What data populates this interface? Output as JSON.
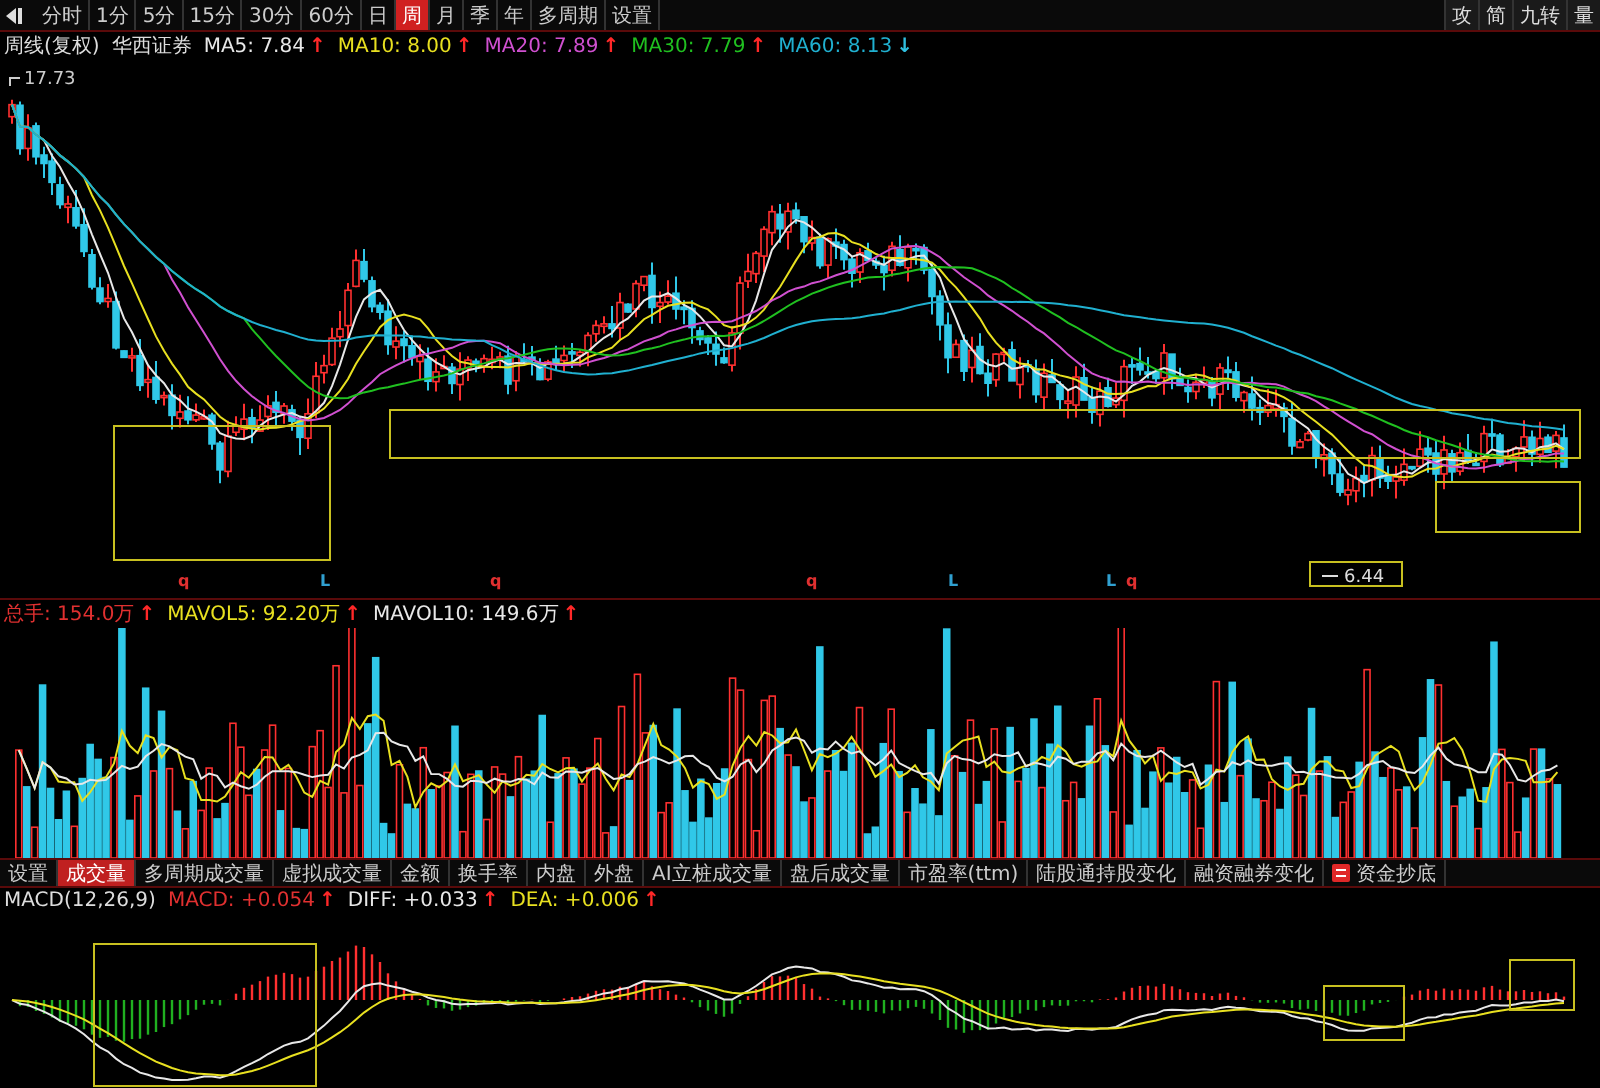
{
  "toolbar": {
    "periods": [
      {
        "label": "分时",
        "selected": false
      },
      {
        "label": "1分",
        "selected": false
      },
      {
        "label": "5分",
        "selected": false
      },
      {
        "label": "15分",
        "selected": false
      },
      {
        "label": "30分",
        "selected": false
      },
      {
        "label": "60分",
        "selected": false
      },
      {
        "label": "日",
        "selected": false
      },
      {
        "label": "周",
        "selected": true
      },
      {
        "label": "月",
        "selected": false
      },
      {
        "label": "季",
        "selected": false
      },
      {
        "label": "年",
        "selected": false
      },
      {
        "label": "多周期",
        "selected": false
      },
      {
        "label": "设置",
        "selected": false
      }
    ],
    "right_buttons": [
      "攻",
      "简",
      "九转",
      "量"
    ]
  },
  "price_legend": {
    "title": "周线(复权)",
    "name": "华西证券",
    "items": [
      {
        "label": "MA5: 7.84",
        "color": "#e8e8e8",
        "arrow": {
          "text": "↑",
          "color": "#ff2828"
        }
      },
      {
        "label": "MA10: 8.00",
        "color": "#e8e020",
        "arrow": {
          "text": "↑",
          "color": "#ff2828"
        }
      },
      {
        "label": "MA20: 7.89",
        "color": "#d050d0",
        "arrow": {
          "text": "↑",
          "color": "#ff2828"
        }
      },
      {
        "label": "MA30: 7.79",
        "color": "#20c020",
        "arrow": {
          "text": "↑",
          "color": "#ff2828"
        }
      },
      {
        "label": "MA60: 8.13",
        "color": "#20b0d0",
        "arrow": {
          "text": "↓",
          "color": "#30c0e0"
        }
      }
    ]
  },
  "price_chart": {
    "high_label": "17.73",
    "low_label": "6.44",
    "markers": [
      {
        "text": "q",
        "color": "#e03030"
      },
      {
        "text": "L",
        "color": "#30a0d0"
      },
      {
        "text": "q",
        "color": "#e03030"
      },
      {
        "text": "q",
        "color": "#e03030"
      },
      {
        "text": "L",
        "color": "#30a0d0"
      },
      {
        "text": "L",
        "color": "#30a0d0"
      },
      {
        "text": "q",
        "color": "#e03030"
      }
    ]
  },
  "volume_legend": {
    "items": [
      {
        "label": "总手: 154.0万",
        "color": "#e03030",
        "arrow": {
          "text": "↑",
          "color": "#ff2828"
        }
      },
      {
        "label": "MAVOL5: 92.20万",
        "color": "#e8e020",
        "arrow": {
          "text": "↑",
          "color": "#ff2828"
        }
      },
      {
        "label": "MAVOL10: 149.6万",
        "color": "#e8e8e8",
        "arrow": {
          "text": "↑",
          "color": "#ff2828"
        }
      }
    ]
  },
  "indicator_tabs": [
    {
      "label": "设置",
      "selected": false,
      "kind": "text"
    },
    {
      "label": "成交量",
      "selected": true,
      "kind": "text"
    },
    {
      "label": "多周期成交量",
      "selected": false,
      "kind": "text"
    },
    {
      "label": "虚拟成交量",
      "selected": false,
      "kind": "text"
    },
    {
      "label": "金额",
      "selected": false,
      "kind": "text"
    },
    {
      "label": "换手率",
      "selected": false,
      "kind": "text"
    },
    {
      "label": "内盘",
      "selected": false,
      "kind": "text"
    },
    {
      "label": "外盘",
      "selected": false,
      "kind": "text"
    },
    {
      "label": "AI立桩成交量",
      "selected": false,
      "kind": "text"
    },
    {
      "label": "盘后成交量",
      "selected": false,
      "kind": "text"
    },
    {
      "label": "市盈率(ttm)",
      "selected": false,
      "kind": "text"
    },
    {
      "label": "陆股通持股变化",
      "selected": false,
      "kind": "text"
    },
    {
      "label": "融资融券变化",
      "selected": false,
      "kind": "text"
    },
    {
      "label": "资金抄底",
      "selected": false,
      "kind": "icon"
    }
  ],
  "macd_legend": {
    "title": "MACD(12,26,9)",
    "items": [
      {
        "label": "MACD: +0.054",
        "color": "#e03030",
        "arrow": {
          "text": "↑",
          "color": "#ff2828"
        }
      },
      {
        "label": "DIFF: +0.033",
        "color": "#e8e8e8",
        "arrow": {
          "text": "↑",
          "color": "#ff2828"
        }
      },
      {
        "label": "DEA: +0.006",
        "color": "#e8e020",
        "arrow": {
          "text": "↑",
          "color": "#ff2828"
        }
      }
    ]
  }
}
